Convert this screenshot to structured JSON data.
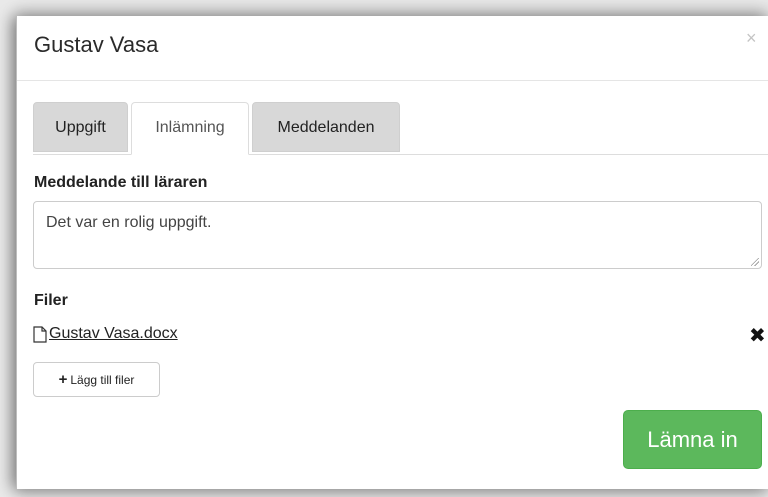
{
  "modal": {
    "title": "Gustav Vasa",
    "close_glyph": "×"
  },
  "tabs": [
    {
      "label": "Uppgift",
      "active": false
    },
    {
      "label": "Inlämning",
      "active": true
    },
    {
      "label": "Meddelanden",
      "active": false
    }
  ],
  "message": {
    "label": "Meddelande till läraren",
    "value": "Det var en rolig uppgift."
  },
  "files": {
    "label": "Filer",
    "items": [
      {
        "name": "Gustav Vasa.docx",
        "icon": "file-icon",
        "remove_glyph": "✖"
      }
    ],
    "add_label": "Lägg till filer",
    "add_glyph": "+"
  },
  "submit_label": "Lämna in",
  "colors": {
    "submit": "#5cb85c",
    "tab_inactive": "#d8d8d8"
  }
}
